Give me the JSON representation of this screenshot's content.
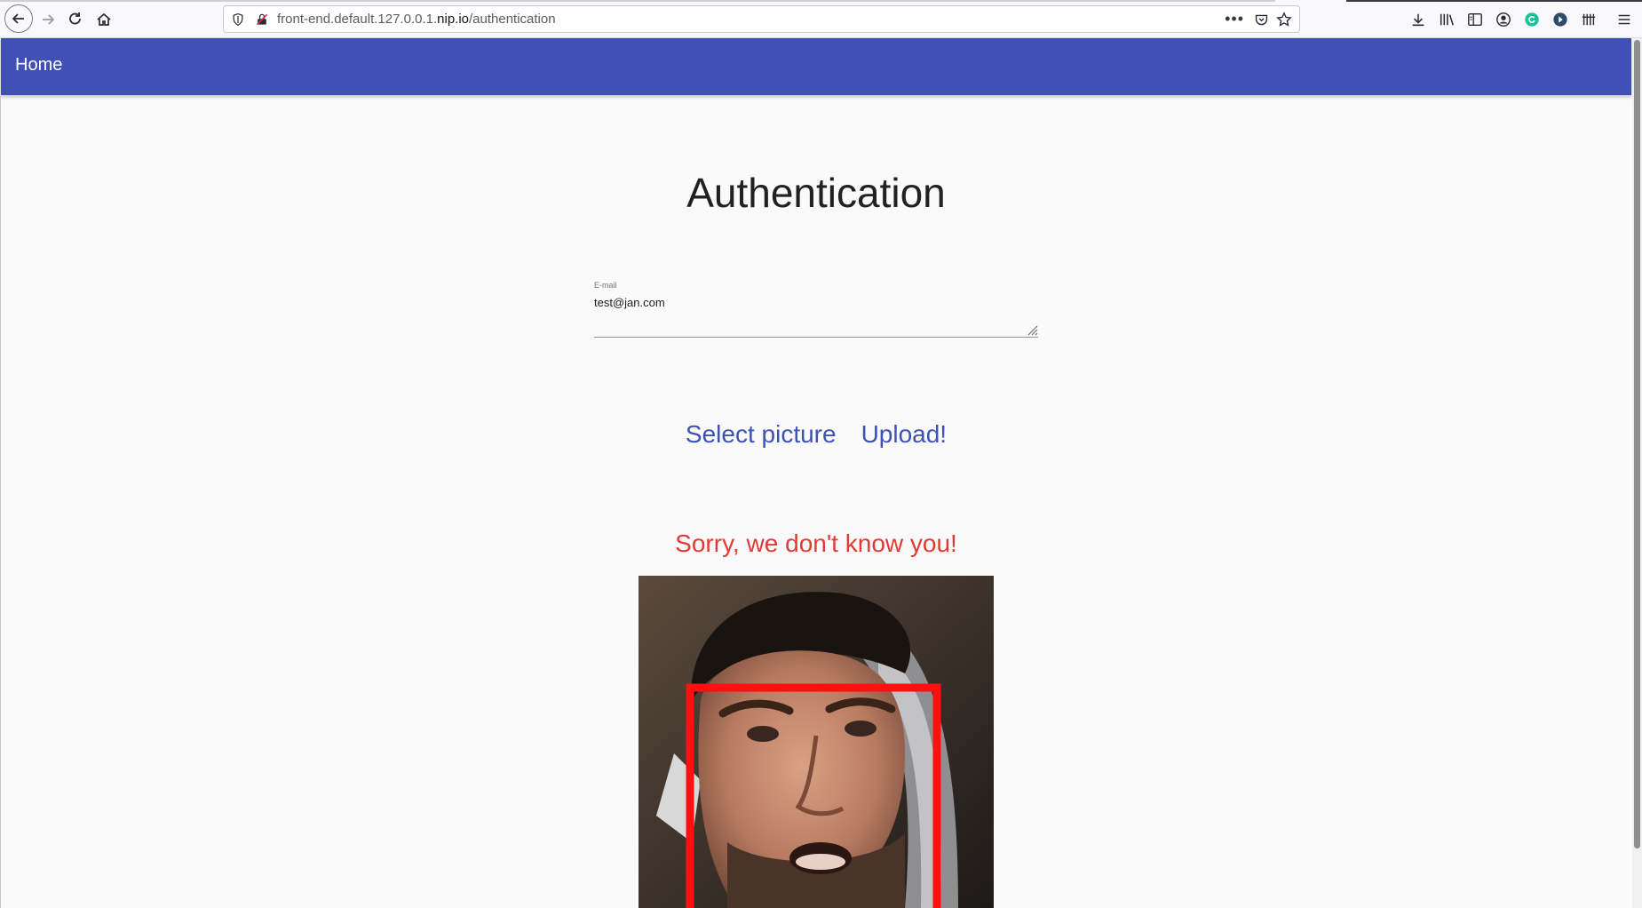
{
  "browser": {
    "url_prefix": "front-end.default.127.0.0.1.",
    "url_domain": "nip.io",
    "url_path": "/authentication",
    "toolbar_icons": [
      "download-icon",
      "library-icon",
      "sidebar-icon",
      "account-icon",
      "grammarly-icon",
      "extension-icon",
      "extension-bars-icon",
      "menu-icon"
    ]
  },
  "appbar": {
    "home_label": "Home",
    "color": "#3f51b5"
  },
  "page": {
    "title": "Authentication",
    "email": {
      "label": "E-mail",
      "value": "test@jan.com"
    },
    "buttons": {
      "select_picture": "Select picture",
      "upload": "Upload!"
    },
    "result_message": "Sorry, we don't know you!",
    "message_color": "#e53935",
    "face_box_color": "#ff1010"
  }
}
